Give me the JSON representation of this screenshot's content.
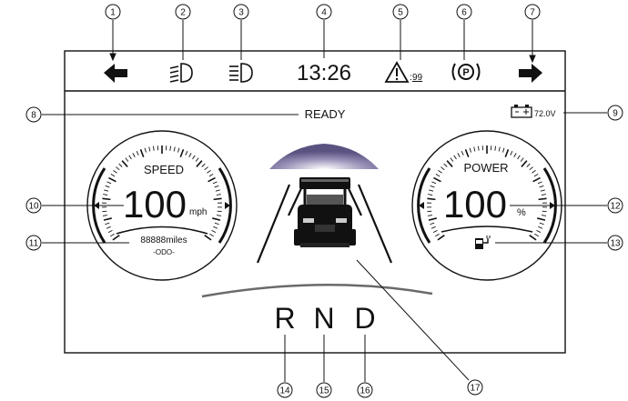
{
  "status_bar": {
    "time": "13:26",
    "warning_count": "99"
  },
  "status_text": "READY",
  "battery_voltage": "72.0V",
  "speed_gauge": {
    "title": "SPEED",
    "value": "100",
    "unit": "mph",
    "odometer_value": "88888miles",
    "odometer_label": "-ODO-"
  },
  "power_gauge": {
    "title": "POWER",
    "value": "100",
    "unit": "%"
  },
  "gears": {
    "reverse": "R",
    "neutral": "N",
    "drive": "D"
  },
  "callouts": [
    "1",
    "2",
    "3",
    "4",
    "5",
    "6",
    "7",
    "8",
    "9",
    "10",
    "11",
    "12",
    "13",
    "14",
    "15",
    "16",
    "17"
  ],
  "icons": [
    "left-turn-arrow-icon",
    "low-beam-icon",
    "high-beam-icon",
    "warning-triangle-icon",
    "parking-brake-icon",
    "right-turn-arrow-icon",
    "battery-icon",
    "charging-plug-icon",
    "golf-cart-icon"
  ]
}
